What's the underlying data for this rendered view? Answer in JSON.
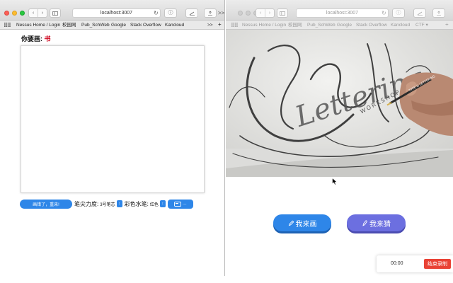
{
  "left_window": {
    "url": "localhost:3007",
    "more_bookmarks": ">>",
    "new_tab": "+",
    "bookmarks": [
      "Nessus Home / Login",
      "校园网",
      "Pub_SchWeb",
      "Google",
      "Stack Overflow",
      "Kancloud"
    ],
    "draw_prompt": {
      "label": "你要画:",
      "word": "书"
    },
    "tools": {
      "redo_label": "画错了，重来!",
      "pen_label": "笔尖力度:",
      "pen_value": "3号笔芯",
      "color_label": "彩色水笔:",
      "color_value": "红色"
    }
  },
  "right_window": {
    "url": "localhost:3007",
    "new_tab": "+",
    "bookmarks": [
      "Nessus Home / Login",
      "校园网",
      "Pub_SchWeb",
      "Google",
      "Stack Overflow",
      "Kancloud",
      "CTF ▾"
    ],
    "hero": {
      "artwork_text": "Lettering",
      "artwork_sub": "WORKSHOP",
      "artwork_tag": "TYPE & LETTERING"
    },
    "buttons": {
      "draw": "我来画",
      "guess": "我来猜"
    }
  },
  "recorder": {
    "time": "00:00",
    "stop_label": "结束录制"
  },
  "colors": {
    "primary_blue": "#2e86e8",
    "purple": "#6c6fe0",
    "stop_red": "#e94235"
  }
}
